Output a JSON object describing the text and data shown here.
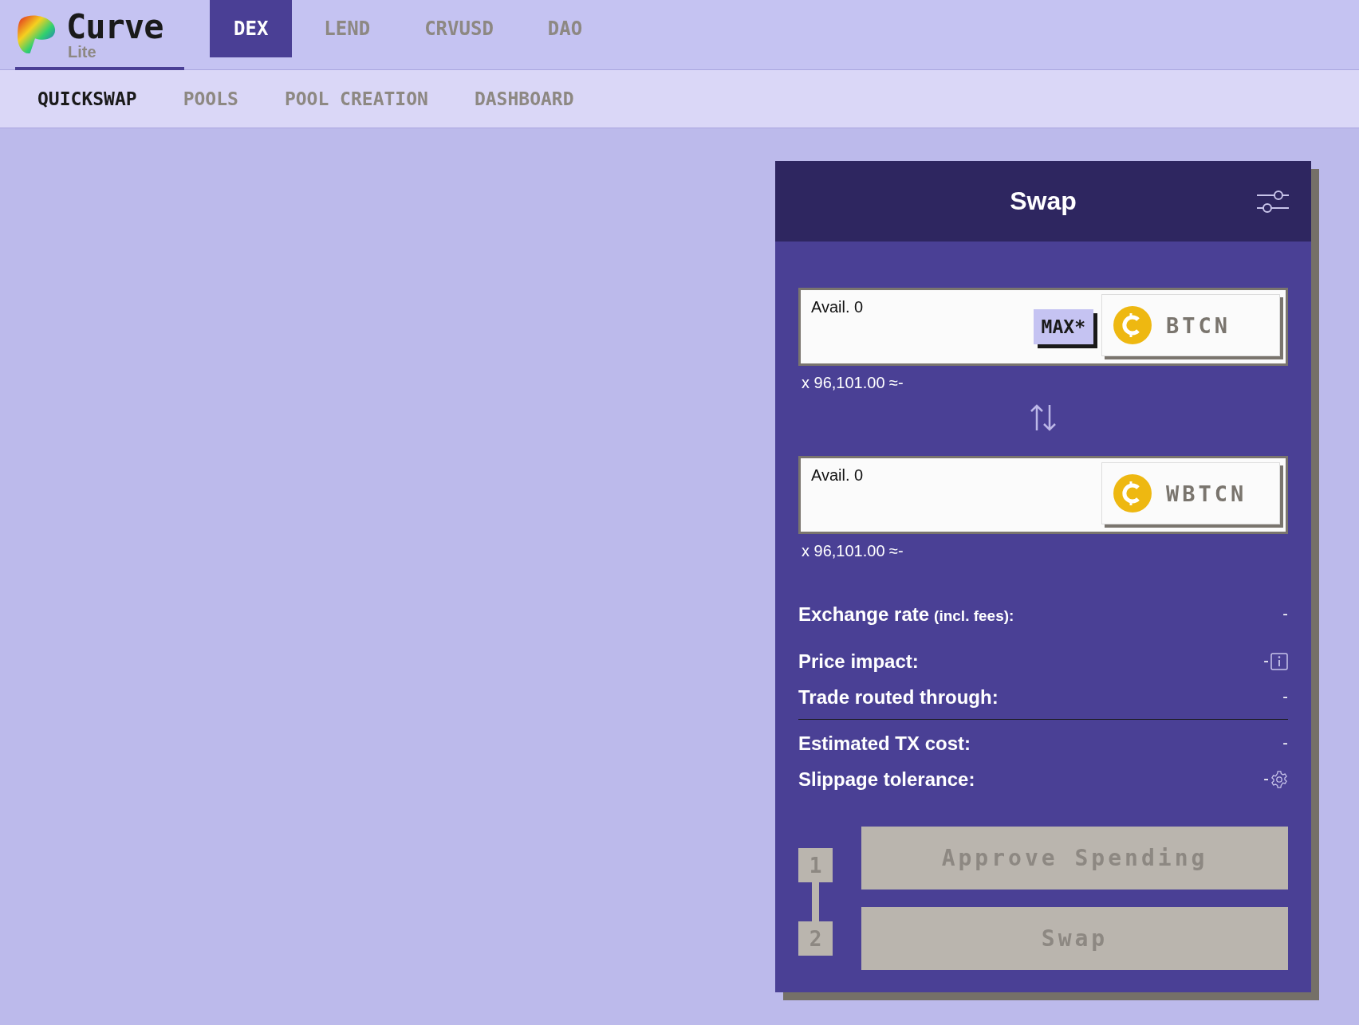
{
  "brand": {
    "name": "Curve",
    "sub": "Lite"
  },
  "main_tabs": [
    {
      "label": "DEX",
      "selected": true
    },
    {
      "label": "LEND",
      "selected": false
    },
    {
      "label": "CRVUSD",
      "selected": false
    },
    {
      "label": "DAO",
      "selected": false
    }
  ],
  "sub_tabs": [
    {
      "label": "QUICKSWAP",
      "selected": true
    },
    {
      "label": "POOLS",
      "selected": false
    },
    {
      "label": "POOL CREATION",
      "selected": false
    },
    {
      "label": "DASHBOARD",
      "selected": false
    }
  ],
  "swap": {
    "title": "Swap",
    "from": {
      "available": "Avail. 0",
      "max": "MAX*",
      "token": "BTCN",
      "usd": "x 96,101.00 ≈-"
    },
    "to": {
      "available": "Avail. 0",
      "token": "WBTCN",
      "usd": "x 96,101.00 ≈-"
    },
    "details": [
      {
        "kind": "value",
        "label": "Exchange rate",
        "note": "(incl. fees):",
        "value": "-"
      },
      {
        "kind": "info",
        "label": "Price impact:",
        "value": "-"
      },
      {
        "kind": "value",
        "label": "Trade routed through:",
        "value": "-"
      }
    ],
    "costs": [
      {
        "kind": "value",
        "label": "Estimated TX cost:",
        "value": "-"
      },
      {
        "kind": "settings",
        "label": "Slippage tolerance:",
        "value": "-"
      }
    ],
    "steps": [
      {
        "number": "1",
        "label": "Approve Spending",
        "disabled": true
      },
      {
        "number": "2",
        "label": "Swap",
        "disabled": true
      }
    ]
  }
}
